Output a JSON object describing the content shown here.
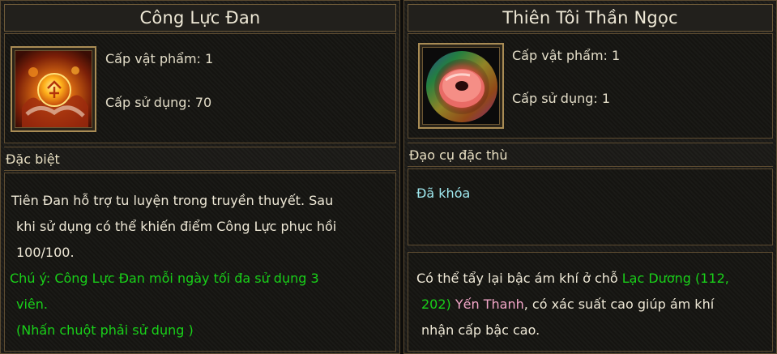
{
  "left_item": {
    "name": "Công Lực Đan",
    "icon": "golden-pill-icon",
    "item_level": "Cấp vật phẩm: 1",
    "use_level": "Cấp sử dụng: 70",
    "category": "Đặc biệt",
    "desc_line1": "Tiên Đan hỗ trợ tu luyện trong truyền thuyết. Sau",
    "desc_line2": "khi sử dụng có thể khiến điểm Công Lực phục hồi",
    "desc_line3": "100/100.",
    "note_line1": "Chú ý: Công Lực Đan mỗi ngày tối đa sử dụng 3",
    "note_line2": "viên.",
    "usage_hint": "(Nhấn chuột phải sử dụng )"
  },
  "right_item": {
    "name": "Thiên Tôi Thần Ngọc",
    "icon": "rainbow-jade-disc-icon",
    "item_level": "Cấp vật phẩm: 1",
    "use_level": "Cấp sử dụng: 1",
    "category": "Đạo cụ đặc thù",
    "lock_status": "Đã khóa",
    "desc_a": "Có thể tẩy lại bậc ám khí ở chỗ ",
    "location_a": "Lạc Dương (112,",
    "location_b": "202)",
    "npc_name": "Yến Thanh",
    "desc_b": ", có xác suất cao giúp ám khí",
    "desc_c": "nhận cấp bậc cao."
  },
  "colors": {
    "highlight_green": "#19d019",
    "lock_cyan": "#9fe8ee",
    "npc_pink": "#f3a6c8",
    "border_gold": "#a98c55"
  }
}
